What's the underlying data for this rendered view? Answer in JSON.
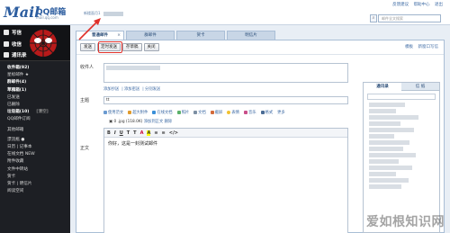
{
  "header": {
    "logo_mail": "Mail",
    "logo_qq": "QQ邮箱",
    "logo_domain": "mail.qq.com",
    "user_label": "新楼面月1",
    "toplinks": [
      "反馈建议",
      "帮助中心",
      "退出"
    ],
    "search_placeholder": "邮件全文搜索"
  },
  "sidebar": {
    "compose": "写信",
    "inbox": "收信",
    "contacts": "通讯录",
    "items": [
      {
        "label": "收件箱(92)",
        "bold": true
      },
      {
        "label": "星标邮件 ★",
        "bold": false
      },
      {
        "label": "群邮件(4)",
        "bold": true
      },
      {
        "label": "草稿箱(1)",
        "bold": true
      },
      {
        "label": "已发送",
        "bold": false
      },
      {
        "label": "已删除",
        "bold": false
      },
      {
        "label": "垃圾箱(10)",
        "bold": true,
        "extra": "[清空]"
      },
      {
        "label": "QQ邮件订阅",
        "bold": false
      },
      {
        "label": "其他邮箱",
        "bold": false,
        "gap": true
      },
      {
        "label": "漂流瓶 ●",
        "bold": false,
        "gap": true
      },
      {
        "label": "日历 | 记事本",
        "bold": false
      },
      {
        "label": "在线文档 NEW",
        "bold": false
      },
      {
        "label": "附件收藏",
        "bold": false
      },
      {
        "label": "文件中转站",
        "bold": false
      },
      {
        "label": "贺卡",
        "bold": false
      },
      {
        "label": "贺卡 | 明信片",
        "bold": false
      },
      {
        "label": "阅读空间",
        "bold": false
      }
    ]
  },
  "tabs": [
    {
      "label": "普通邮件",
      "active": true
    },
    {
      "label": "群邮件",
      "active": false
    },
    {
      "label": "贺卡",
      "active": false
    },
    {
      "label": "明信片",
      "active": false
    }
  ],
  "toolbar": {
    "send": "发送",
    "scheduled_send": "定时发送",
    "save_draft": "存草稿",
    "close": "关闭",
    "right_links": [
      "模板",
      "新窗口写信"
    ]
  },
  "form": {
    "to_label": "收件人",
    "sub_links": [
      "添加抄送",
      "添加密送",
      "分别发送"
    ],
    "subject_label": "主题",
    "subject_value": "tt",
    "body_label": "正文",
    "editor_tools": [
      "使用范文",
      "超大附件",
      "在线文档",
      "照片",
      "文档",
      "截屏",
      "表情",
      "音乐",
      "格式",
      "更多"
    ],
    "attachment_name": "0 .jpg (118.0K)",
    "attachment_links": [
      "添加到正文",
      "删除"
    ],
    "format_buttons": [
      "B",
      "I",
      "U",
      "T",
      "T",
      "A",
      "A",
      "≡",
      "≡",
      "</>"
    ],
    "body_text": "你好，这是一封测试邮件"
  },
  "contacts_panel": {
    "tabs": [
      "通讯录",
      "信 纸"
    ]
  },
  "watermark": "爱如根知识网"
}
